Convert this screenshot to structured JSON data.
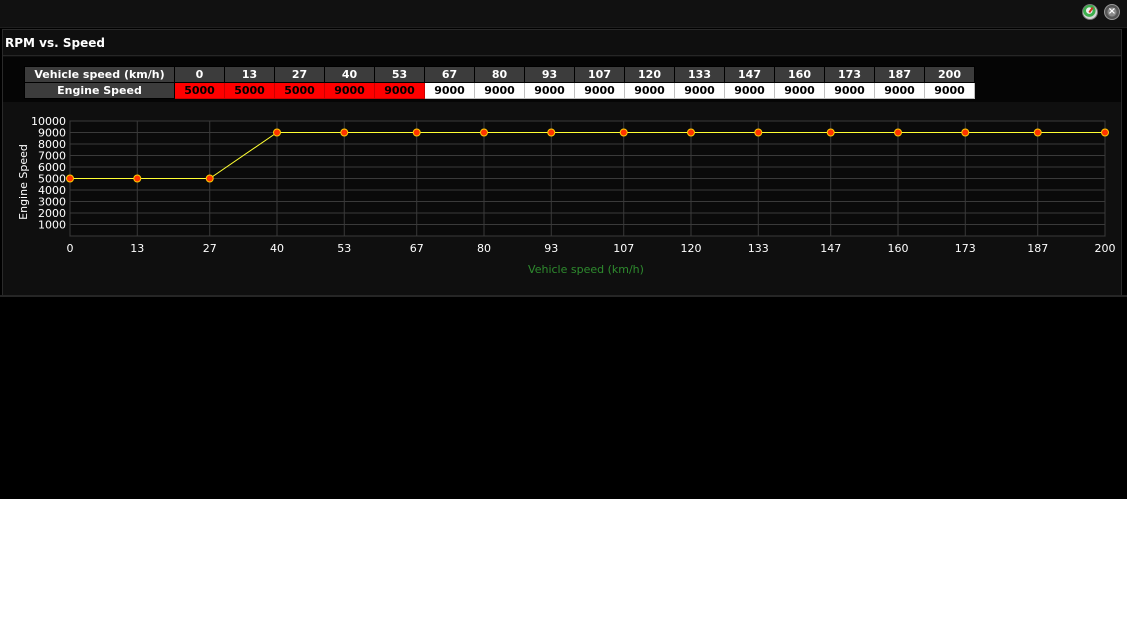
{
  "panel": {
    "title": "RPM vs. Speed"
  },
  "icons": {
    "gauge": "gauge-icon",
    "close": "close-icon"
  },
  "table": {
    "header_label": "Vehicle speed (km/h)",
    "row_label": "Engine Speed",
    "speeds": [
      "0",
      "13",
      "27",
      "40",
      "53",
      "67",
      "80",
      "93",
      "107",
      "120",
      "133",
      "147",
      "160",
      "173",
      "187",
      "200"
    ],
    "rpms": [
      "5000",
      "5000",
      "5000",
      "9000",
      "9000",
      "9000",
      "9000",
      "9000",
      "9000",
      "9000",
      "9000",
      "9000",
      "9000",
      "9000",
      "9000",
      "9000"
    ],
    "highlighted_count": 5,
    "highlight_color": "#ff0000"
  },
  "chart_data": {
    "type": "line",
    "x": [
      0,
      13,
      27,
      40,
      53,
      67,
      80,
      93,
      107,
      120,
      133,
      147,
      160,
      173,
      187,
      200
    ],
    "y": [
      5000,
      5000,
      5000,
      9000,
      9000,
      9000,
      9000,
      9000,
      9000,
      9000,
      9000,
      9000,
      9000,
      9000,
      9000,
      9000
    ],
    "x_tick_labels": [
      "0",
      "13",
      "27",
      "40",
      "53",
      "67",
      "80",
      "93",
      "107",
      "120",
      "133",
      "147",
      "160",
      "173",
      "187",
      "200"
    ],
    "y_ticks": [
      1000,
      2000,
      3000,
      4000,
      5000,
      6000,
      7000,
      8000,
      9000,
      10000
    ],
    "xlabel": "Vehicle speed (km/h)",
    "ylabel": "Engine Speed",
    "ylim": [
      0,
      10000
    ],
    "grid": true,
    "line_color": "#ffff33",
    "marker_color": "#ff3300",
    "xlabel_color": "#2e8b2e"
  }
}
